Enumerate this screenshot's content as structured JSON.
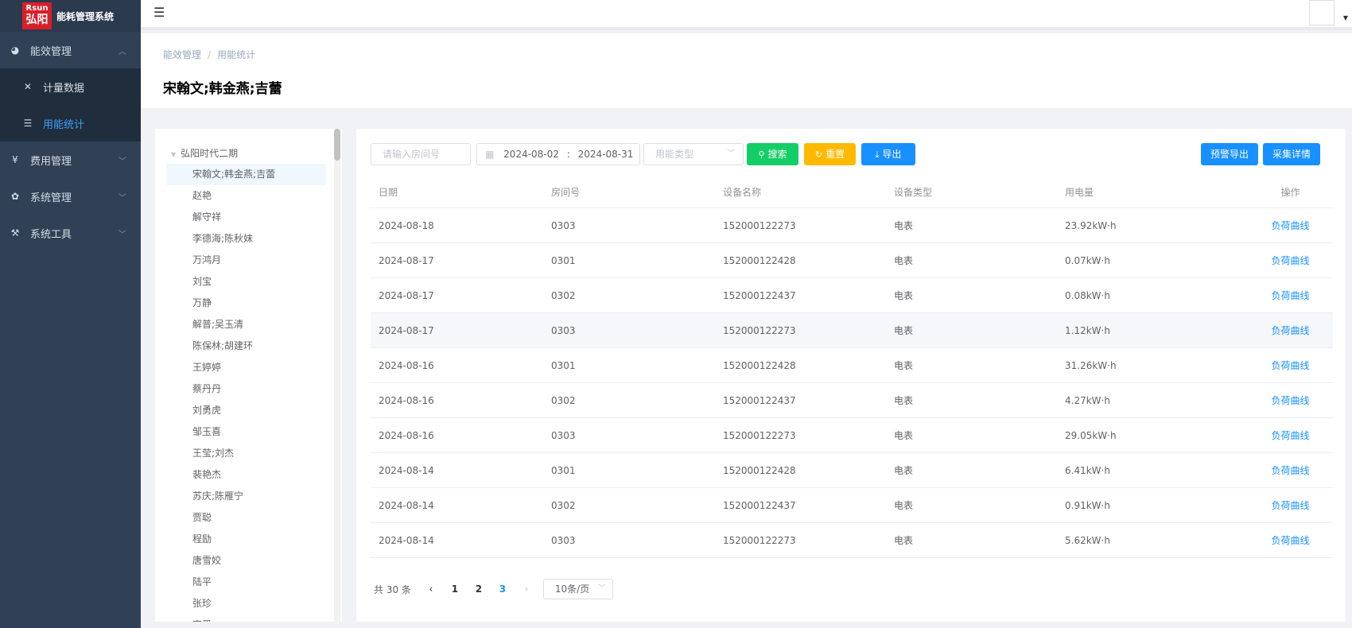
{
  "app": {
    "logo_top": "Rsun",
    "logo_bottom": "弘阳",
    "title": "能耗管理系统"
  },
  "sidebar": {
    "items": [
      {
        "label": "能效管理",
        "icon": "dashboard-icon",
        "expanded": true
      },
      {
        "label": "计量数据",
        "icon": "tools-icon",
        "sub": true
      },
      {
        "label": "用能统计",
        "icon": "database-icon",
        "sub": true,
        "active": true
      },
      {
        "label": "费用管理",
        "icon": "yen-icon"
      },
      {
        "label": "系统管理",
        "icon": "gear-icon"
      },
      {
        "label": "系统工具",
        "icon": "toolkit-icon"
      }
    ]
  },
  "breadcrumb": {
    "items": [
      "能效管理",
      "用能统计"
    ],
    "separator": "/"
  },
  "page_title": "宋翰文;韩金燕;吉蕾",
  "tree": {
    "root": "弘阳时代二期",
    "nodes": [
      "宋翰文;韩金燕;吉蕾",
      "赵艳",
      "解守祥",
      "李德海;陈秋妹",
      "万鸿月",
      "刘宝",
      "万静",
      "解普;吴玉清",
      "陈保林;胡建环",
      "王婷婷",
      "蔡丹丹",
      "刘勇虎",
      "邹玉喜",
      "王莹;刘杰",
      "裴艳杰",
      "苏庆;陈雁宁",
      "贾聪",
      "程励",
      "唐雪姣",
      "陆平",
      "张珍",
      "宋黑"
    ]
  },
  "filters": {
    "room_placeholder": "请输入房间号",
    "date_start": "2024-08-02",
    "date_sep": ":",
    "date_end": "2024-08-31",
    "type_placeholder": "用能类型",
    "search": "搜索",
    "reset": "重置",
    "export": "导出",
    "warn_export": "预警导出",
    "collect_detail": "采集详情"
  },
  "table": {
    "headers": [
      "日期",
      "房间号",
      "设备名称",
      "设备类型",
      "用电量",
      "操作"
    ],
    "rows": [
      [
        "2024-08-18",
        "0303",
        "152000122273",
        "电表",
        "23.92kW·h",
        "负荷曲线"
      ],
      [
        "2024-08-17",
        "0301",
        "152000122428",
        "电表",
        "0.07kW·h",
        "负荷曲线"
      ],
      [
        "2024-08-17",
        "0302",
        "152000122437",
        "电表",
        "0.08kW·h",
        "负荷曲线"
      ],
      [
        "2024-08-17",
        "0303",
        "152000122273",
        "电表",
        "1.12kW·h",
        "负荷曲线"
      ],
      [
        "2024-08-16",
        "0301",
        "152000122428",
        "电表",
        "31.26kW·h",
        "负荷曲线"
      ],
      [
        "2024-08-16",
        "0302",
        "152000122437",
        "电表",
        "4.27kW·h",
        "负荷曲线"
      ],
      [
        "2024-08-16",
        "0303",
        "152000122273",
        "电表",
        "29.05kW·h",
        "负荷曲线"
      ],
      [
        "2024-08-14",
        "0301",
        "152000122428",
        "电表",
        "6.41kW·h",
        "负荷曲线"
      ],
      [
        "2024-08-14",
        "0302",
        "152000122437",
        "电表",
        "0.91kW·h",
        "负荷曲线"
      ],
      [
        "2024-08-14",
        "0303",
        "152000122273",
        "电表",
        "5.62kW·h",
        "负荷曲线"
      ]
    ],
    "hover_row": 3
  },
  "pagination": {
    "total": "共 30 条",
    "pages": [
      "1",
      "2",
      "3"
    ],
    "current": "3",
    "page_size": "10条/页"
  },
  "colors": {
    "sidebar_bg": "#304156",
    "accent": "#1890ff",
    "search_btn": "#13ce66",
    "reset_btn": "#ffba00",
    "logo_red": "#d71f2a"
  }
}
